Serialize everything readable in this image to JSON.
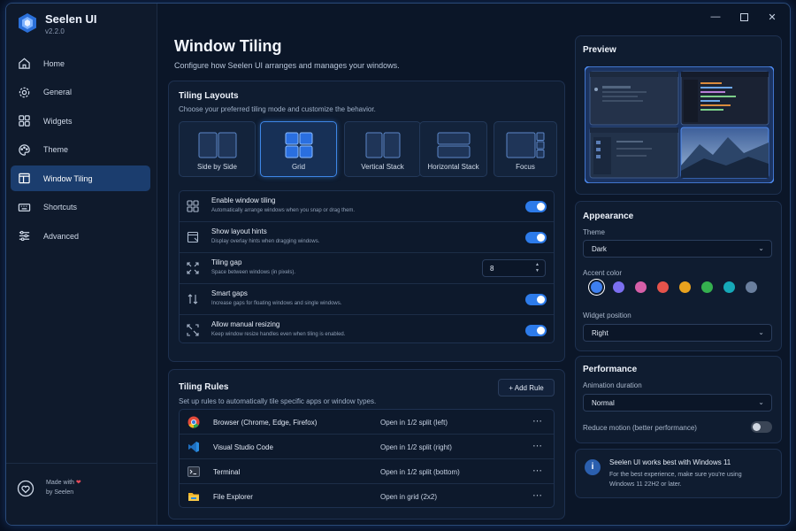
{
  "app": {
    "name": "Seelen UI",
    "version": "v2.2.0"
  },
  "nav": {
    "items": [
      {
        "label": "Home",
        "icon": "home-icon"
      },
      {
        "label": "General",
        "icon": "gear-icon"
      },
      {
        "label": "Widgets",
        "icon": "widgets-grid-icon"
      },
      {
        "label": "Theme",
        "icon": "palette-icon"
      },
      {
        "label": "Window Tiling",
        "icon": "window-tiling-icon",
        "active": true
      },
      {
        "label": "Shortcuts",
        "icon": "keyboard-icon"
      },
      {
        "label": "Advanced",
        "icon": "sliders-icon"
      }
    ]
  },
  "footer": {
    "made_with": "Made with",
    "by": "by Seelen"
  },
  "page": {
    "title": "Window Tiling",
    "subtitle": "Configure how Seelen UI arranges and manages your windows."
  },
  "layouts": {
    "title": "Tiling Layouts",
    "subtitle": "Choose your preferred tiling mode and customize the behavior.",
    "items": [
      {
        "label": "Side by Side",
        "selected": false
      },
      {
        "label": "Grid",
        "selected": true
      },
      {
        "label": "Vertical Stack",
        "selected": false
      },
      {
        "label": "Horizontal Stack",
        "selected": false
      },
      {
        "label": "Focus",
        "selected": false
      }
    ]
  },
  "options": {
    "enable_tiling": {
      "title": "Enable window tiling",
      "desc": "Automatically arrange windows when you snap or drag them.",
      "on": true
    },
    "layout_hints": {
      "title": "Show layout hints",
      "desc": "Display overlay hints when dragging windows.",
      "on": true
    },
    "tiling_gap": {
      "title": "Tiling gap",
      "desc": "Space between windows (in pixels).",
      "value": "8"
    },
    "smart_gaps": {
      "title": "Smart gaps",
      "desc": "Increase gaps for floating windows and single windows.",
      "on": true
    },
    "manual_resize": {
      "title": "Allow manual resizing",
      "desc": "Keep window resize handles even when tiling is enabled.",
      "on": true
    }
  },
  "rules": {
    "title": "Tiling Rules",
    "subtitle": "Set up rules to automatically tile specific apps or window types.",
    "add_label": "+ Add Rule",
    "items": [
      {
        "app": "Browser (Chrome, Edge, Firefox)",
        "action": "Open in 1/2 split (left)",
        "icon": "chrome-icon"
      },
      {
        "app": "Visual Studio Code",
        "action": "Open in 1/2 split (right)",
        "icon": "vscode-icon"
      },
      {
        "app": "Terminal",
        "action": "Open in 1/2 split (bottom)",
        "icon": "terminal-icon"
      },
      {
        "app": "File Explorer",
        "action": "Open in grid (2x2)",
        "icon": "folder-icon"
      }
    ],
    "more": "⋯"
  },
  "preview": {
    "title": "Preview"
  },
  "appearance": {
    "title": "Appearance",
    "theme_label": "Theme",
    "theme_value": "Dark",
    "accent_label": "Accent color",
    "accents": [
      "#3d7ff0",
      "#7b6ff0",
      "#d65fa8",
      "#e5534b",
      "#e9a21e",
      "#35b04f",
      "#16a9b8",
      "#6a7f9e"
    ],
    "accent_selected": 0,
    "position_label": "Widget position",
    "position_value": "Right"
  },
  "performance": {
    "title": "Performance",
    "anim_label": "Animation duration",
    "anim_value": "Normal",
    "reduce_label": "Reduce motion (better performance)",
    "reduce_on": false
  },
  "notice": {
    "title": "Seelen UI works best with Windows 11",
    "body_1": "For the best experience, make sure you're using",
    "body_2": "Windows 11 22H2 or later."
  },
  "colors": {
    "accent": "#2d7bea",
    "background": "#0b1628",
    "card": "#0f1c30"
  }
}
